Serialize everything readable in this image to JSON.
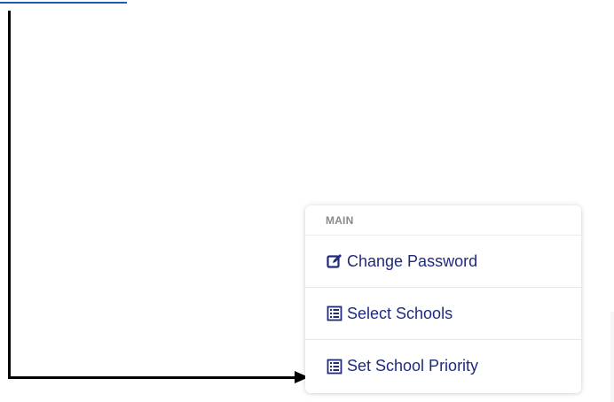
{
  "menu": {
    "section_label": "MAIN",
    "items": [
      {
        "label": "Change Password",
        "icon": "edit-icon"
      },
      {
        "label": "Select Schools",
        "icon": "list-icon"
      },
      {
        "label": "Set School Priority",
        "icon": "list-icon"
      }
    ]
  },
  "colors": {
    "menu_text": "#1f2a80",
    "section_text": "#8a8a8a",
    "arrow": "#000000",
    "link_underline": "#1e5bb8"
  }
}
